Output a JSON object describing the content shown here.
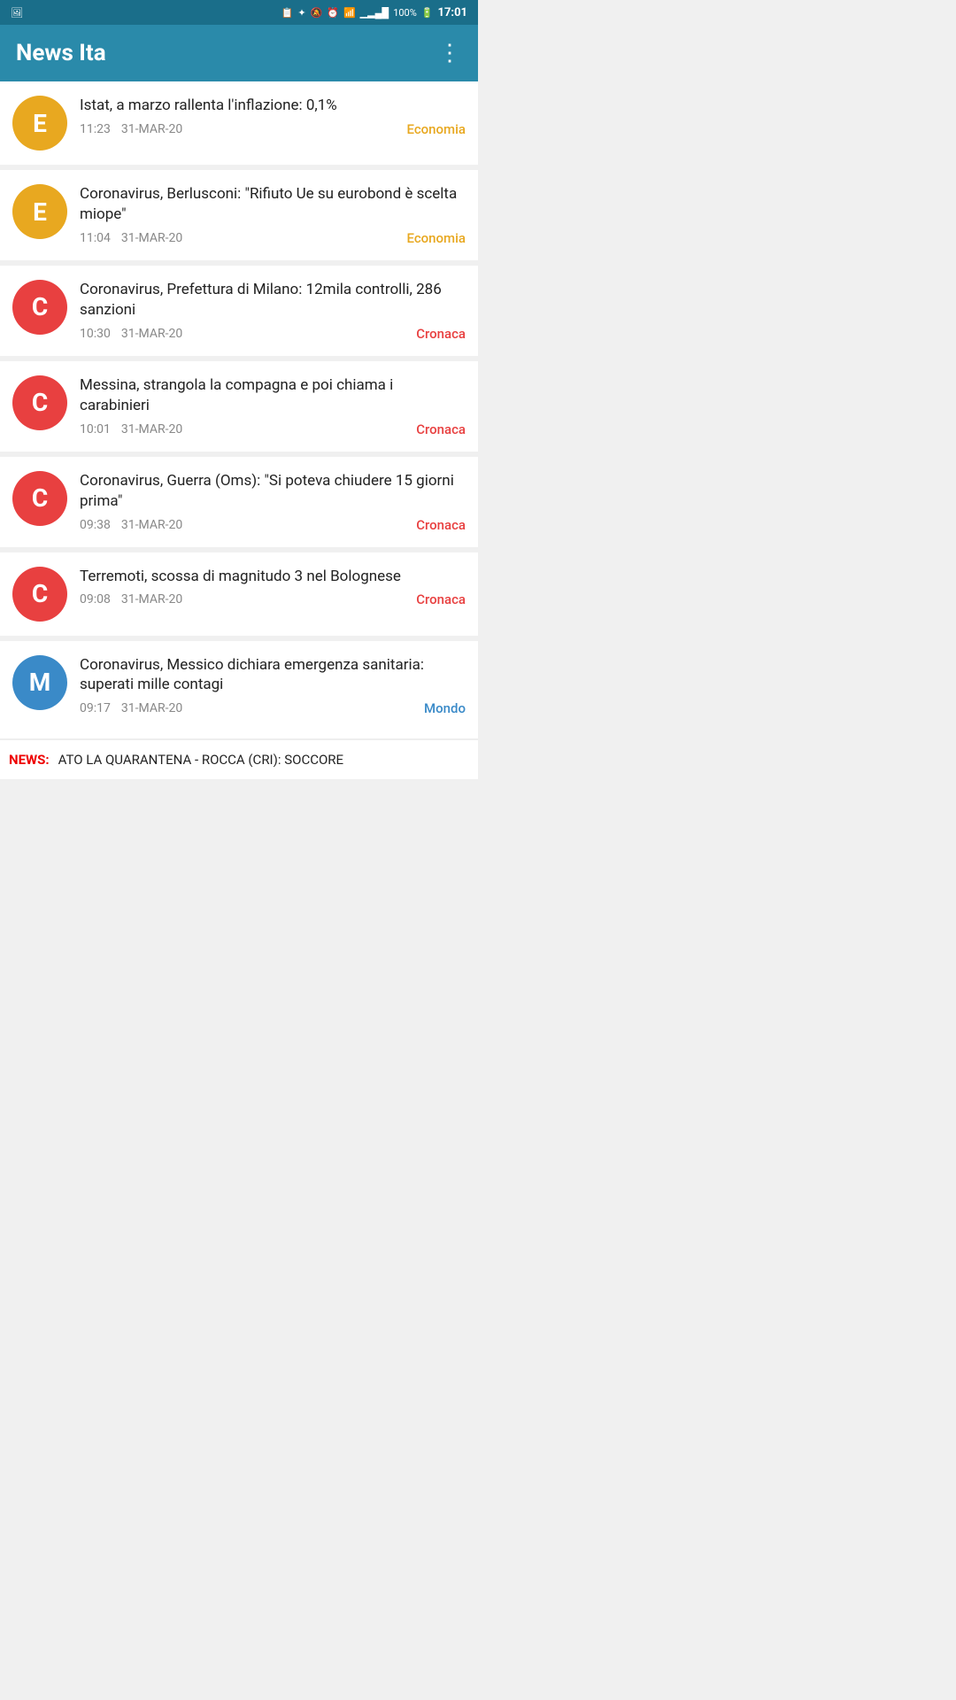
{
  "statusBar": {
    "time": "17:01",
    "battery": "100%",
    "signal": "▂▄▆█",
    "wifi": "WiFi",
    "icons": [
      "📷",
      "🔋",
      "🔕",
      "⏰",
      "📶",
      "100%",
      "17:01"
    ]
  },
  "appBar": {
    "title": "News Ita",
    "moreIcon": "⋮"
  },
  "newsList": [
    {
      "id": 1,
      "avatarLetter": "E",
      "avatarColor": "yellow",
      "title": "Istat, a marzo rallenta l'inflazione: 0,1%",
      "time": "11:23",
      "date": "31-MAR-20",
      "category": "Economia",
      "categoryClass": "cat-economia"
    },
    {
      "id": 2,
      "avatarLetter": "E",
      "avatarColor": "yellow",
      "title": "Coronavirus, Berlusconi: \"Rifiuto Ue su eurobond è scelta miope\"",
      "time": "11:04",
      "date": "31-MAR-20",
      "category": "Economia",
      "categoryClass": "cat-economia"
    },
    {
      "id": 3,
      "avatarLetter": "C",
      "avatarColor": "red",
      "title": "Coronavirus, Prefettura di Milano: 12mila controlli, 286 sanzioni",
      "time": "10:30",
      "date": "31-MAR-20",
      "category": "Cronaca",
      "categoryClass": "cat-cronaca"
    },
    {
      "id": 4,
      "avatarLetter": "C",
      "avatarColor": "red",
      "title": "Messina, strangola la compagna e poi chiama i carabinieri",
      "time": "10:01",
      "date": "31-MAR-20",
      "category": "Cronaca",
      "categoryClass": "cat-cronaca"
    },
    {
      "id": 5,
      "avatarLetter": "C",
      "avatarColor": "red",
      "title": "Coronavirus, Guerra (Oms): \"Si poteva chiudere 15 giorni prima\"",
      "time": "09:38",
      "date": "31-MAR-20",
      "category": "Cronaca",
      "categoryClass": "cat-cronaca"
    },
    {
      "id": 6,
      "avatarLetter": "C",
      "avatarColor": "red",
      "title": "Terremoti, scossa di magnitudo 3 nel Bolognese",
      "time": "09:08",
      "date": "31-MAR-20",
      "category": "Cronaca",
      "categoryClass": "cat-cronaca"
    },
    {
      "id": 7,
      "avatarLetter": "M",
      "avatarColor": "blue",
      "title": "Coronavirus, Messico dichiara emergenza sanitaria: superati mille contagi",
      "time": "09:17",
      "date": "31-MAR-20",
      "category": "Mondo",
      "categoryClass": "cat-mondo",
      "partial": true
    }
  ],
  "ticker": {
    "label": "NEWS:",
    "text": " ATO LA QUARANTENA  -  ROCCA (CRI): SOCCORE"
  }
}
